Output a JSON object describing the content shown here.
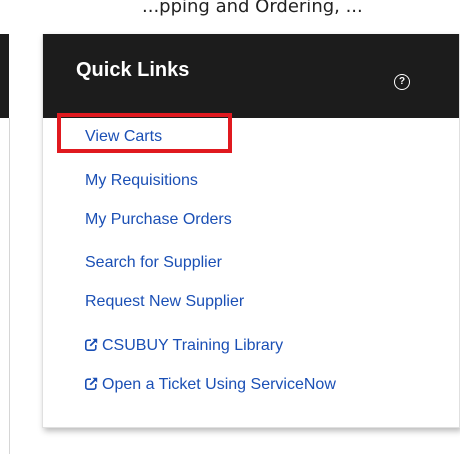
{
  "page": {
    "partial_top_text": "...pping and Ordering, ..."
  },
  "widget": {
    "title": "Quick Links",
    "help_icon": "question-circle-icon",
    "links": [
      {
        "label": "View Carts",
        "external": false
      },
      {
        "label": "My Requisitions",
        "external": false
      },
      {
        "label": "My Purchase Orders",
        "external": false
      },
      {
        "label": "Search for Supplier",
        "external": false
      },
      {
        "label": "Request New Supplier",
        "external": false
      },
      {
        "label": "CSUBUY Training Library",
        "external": true
      },
      {
        "label": "Open a Ticket Using ServiceNow",
        "external": true
      }
    ],
    "highlighted_link": "View Carts"
  },
  "colors": {
    "header_bg": "#1c1c1c",
    "link_color": "#1a4fb5",
    "highlight_border": "#e0191f"
  }
}
